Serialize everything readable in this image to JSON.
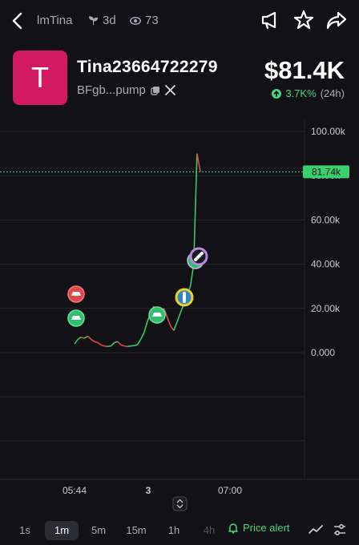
{
  "header": {
    "username": "lmTina",
    "age": "3d",
    "views": "73"
  },
  "token": {
    "avatar_letter": "T",
    "name": "Tina23664722279",
    "address": "BFgb...pump",
    "price": "$81.4K",
    "change": "3.7K%",
    "change_period": "(24h)"
  },
  "chart_data": {
    "type": "line",
    "y_ticks": [
      "100.00k",
      "80.00k",
      "60.00k",
      "40.00k",
      "20.00k",
      "0.000"
    ],
    "x_ticks": [
      "05:44",
      "3",
      "07:00"
    ],
    "current_label": "81.74k",
    "ylim": [
      0,
      100000
    ],
    "series": [
      {
        "values": [
          4000,
          6000,
          7000,
          6500,
          7500,
          6000,
          5000,
          4500,
          3500,
          3000,
          2800,
          3000,
          4500,
          5000,
          3500,
          3000,
          2800,
          3000,
          3200,
          3500,
          6000,
          9000,
          14000,
          18000,
          21000,
          17000,
          15000,
          20000,
          16000,
          12000,
          10000,
          14000,
          18000,
          22000,
          26000,
          30000,
          40000,
          90000,
          81740
        ]
      }
    ],
    "colors": {
      "up": "#3ec46d",
      "down": "#e04848",
      "line": "#4ad67e"
    }
  },
  "timeframes": [
    "1s",
    "1m",
    "5m",
    "15m",
    "1h",
    "4h"
  ],
  "active_timeframe": "1m",
  "price_alert_label": "Price alert"
}
